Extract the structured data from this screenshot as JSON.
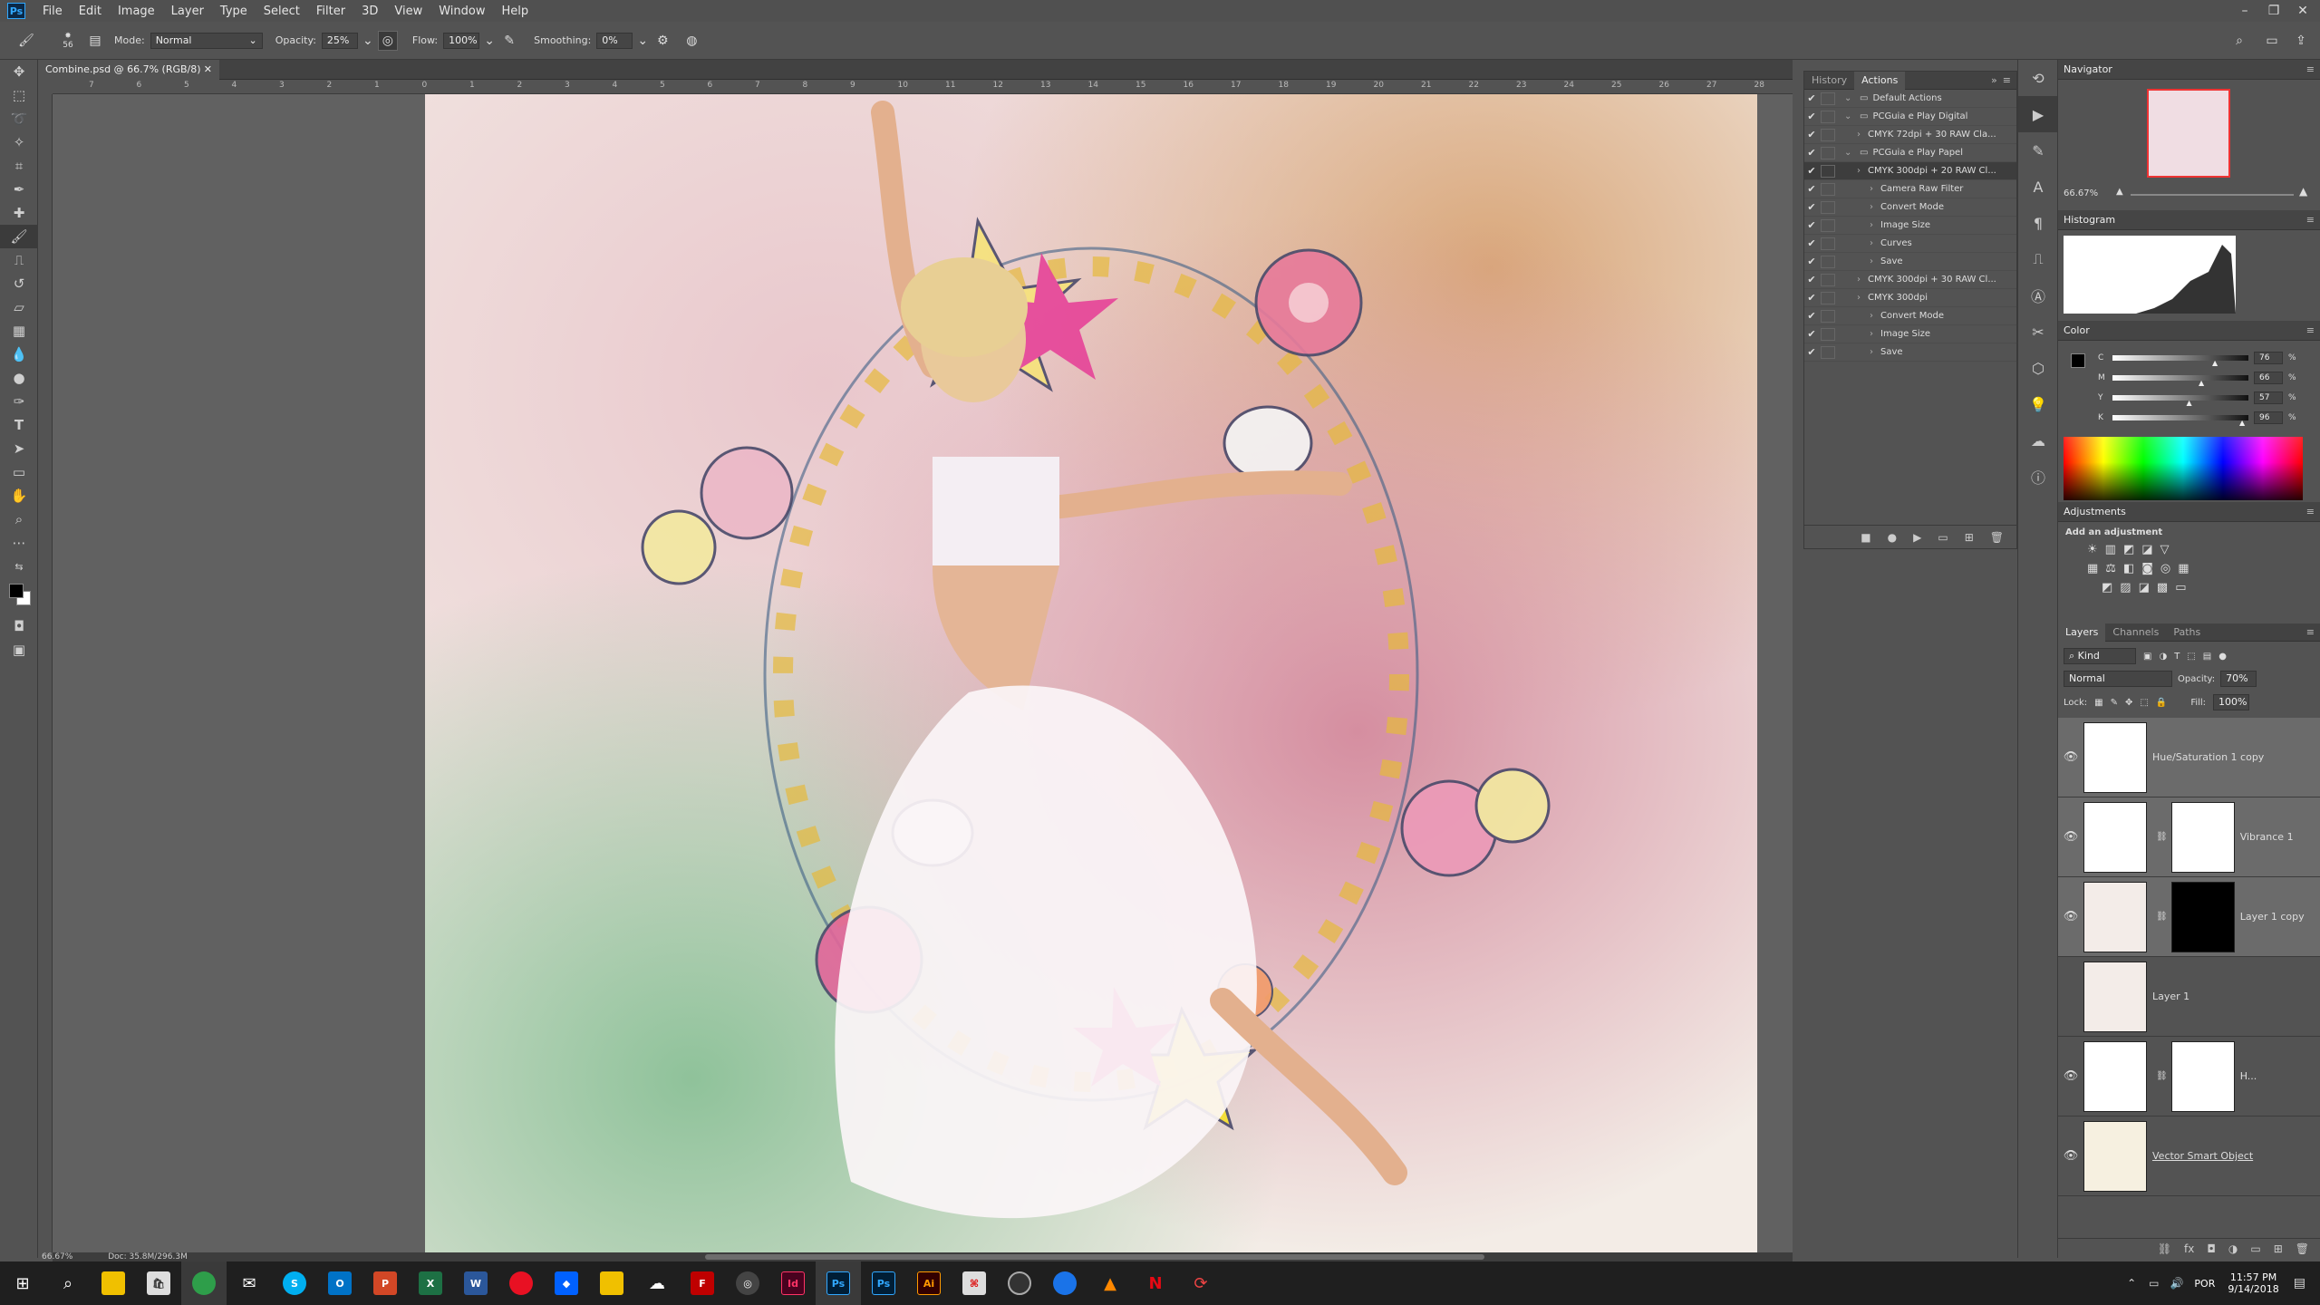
{
  "app": {
    "logo": "Ps"
  },
  "menu": [
    "File",
    "Edit",
    "Image",
    "Layer",
    "Type",
    "Select",
    "Filter",
    "3D",
    "View",
    "Window",
    "Help"
  ],
  "options": {
    "brush_size": "56",
    "mode_label": "Mode:",
    "mode_value": "Normal",
    "opacity_label": "Opacity:",
    "opacity_value": "25%",
    "flow_label": "Flow:",
    "flow_value": "100%",
    "smoothing_label": "Smoothing:",
    "smoothing_value": "0%"
  },
  "document": {
    "tab_title": "Combine.psd @ 66.7% (RGB/8)",
    "zoom": "66.67%",
    "doc_info": "Doc: 35.8M/296.3M"
  },
  "ruler": {
    "top": [
      "7",
      "6",
      "5",
      "4",
      "3",
      "2",
      "1",
      "0",
      "1",
      "2",
      "3",
      "4",
      "5",
      "6",
      "7",
      "8",
      "9",
      "10",
      "11",
      "12",
      "13",
      "14",
      "15",
      "16",
      "17",
      "18",
      "19",
      "20",
      "21",
      "22",
      "23",
      "24",
      "25",
      "26",
      "27",
      "28"
    ]
  },
  "history_panel": {
    "tabs": [
      "History",
      "Actions"
    ],
    "actions": [
      {
        "label": "Default Actions",
        "indent": 0,
        "folder": true,
        "check": true
      },
      {
        "label": "PCGuia e Play Digital",
        "indent": 0,
        "folder": true,
        "check": true
      },
      {
        "label": "CMYK 72dpi + 30 RAW Cla...",
        "indent": 1,
        "folder": false,
        "check": true
      },
      {
        "label": "PCGuia e Play Papel",
        "indent": 0,
        "folder": true,
        "check": true
      },
      {
        "label": "CMYK 300dpi + 20 RAW Cl...",
        "indent": 1,
        "folder": false,
        "check": true,
        "selected": true
      },
      {
        "label": "Camera Raw Filter",
        "indent": 2,
        "folder": false,
        "check": true
      },
      {
        "label": "Convert Mode",
        "indent": 2,
        "folder": false,
        "check": true
      },
      {
        "label": "Image Size",
        "indent": 2,
        "folder": false,
        "check": true
      },
      {
        "label": "Curves",
        "indent": 2,
        "folder": false,
        "check": true
      },
      {
        "label": "Save",
        "indent": 2,
        "folder": false,
        "check": true
      },
      {
        "label": "CMYK 300dpi + 30 RAW Cl...",
        "indent": 1,
        "folder": false,
        "check": true
      },
      {
        "label": "CMYK 300dpi",
        "indent": 1,
        "folder": false,
        "check": true
      },
      {
        "label": "Convert Mode",
        "indent": 2,
        "folder": false,
        "check": true
      },
      {
        "label": "Image Size",
        "indent": 2,
        "folder": false,
        "check": true
      },
      {
        "label": "Save",
        "indent": 2,
        "folder": false,
        "check": true
      }
    ]
  },
  "navigator": {
    "title": "Navigator",
    "zoom": "66.67%"
  },
  "histogram": {
    "title": "Histogram"
  },
  "color": {
    "title": "Color",
    "channels": [
      {
        "name": "C",
        "value": "76",
        "unit": "%"
      },
      {
        "name": "M",
        "value": "66",
        "unit": "%"
      },
      {
        "name": "Y",
        "value": "57",
        "unit": "%"
      },
      {
        "name": "K",
        "value": "96",
        "unit": "%"
      }
    ]
  },
  "adjustments": {
    "title": "Adjustments",
    "subtitle": "Add an adjustment"
  },
  "layers": {
    "tabs": [
      "Layers",
      "Channels",
      "Paths"
    ],
    "filter": "Kind",
    "blend": "Normal",
    "opacity_label": "Opacity:",
    "opacity_value": "70%",
    "lock_label": "Lock:",
    "fill_label": "Fill:",
    "fill_value": "100%",
    "items": [
      {
        "name": "Hue/Saturation 1 copy",
        "visible": true,
        "selected": true
      },
      {
        "name": "Vibrance 1",
        "visible": true,
        "selected": true
      },
      {
        "name": "Layer 1 copy",
        "visible": true,
        "selected": true
      },
      {
        "name": "Layer 1",
        "visible": false,
        "selected": false
      },
      {
        "name": "H...",
        "visible": true,
        "selected": false
      },
      {
        "name": "Vector Smart Object",
        "visible": true,
        "selected": false
      }
    ]
  },
  "taskbar": {
    "time": "11:57 PM",
    "date": "9/14/2018",
    "lang": "POR"
  },
  "colors": {
    "ps_blue": "#31a8ff",
    "panel": "#535353",
    "dark": "#424242"
  }
}
